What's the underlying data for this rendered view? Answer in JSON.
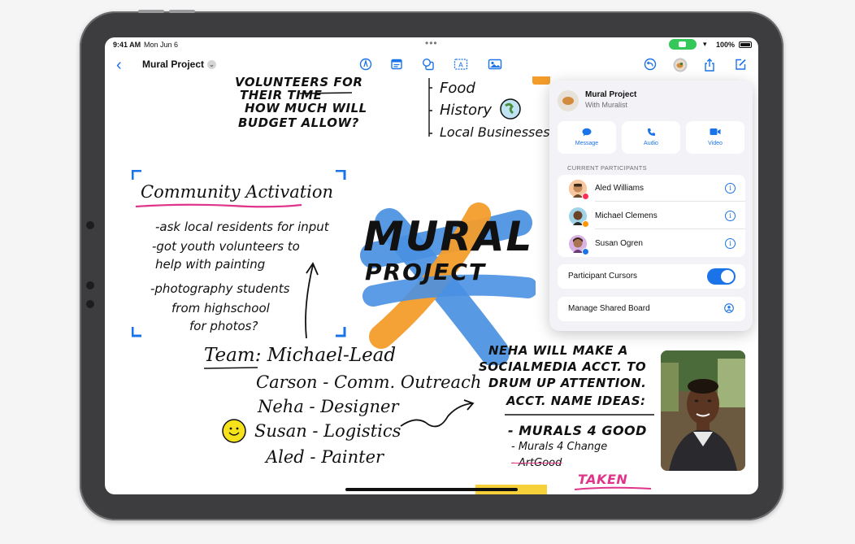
{
  "status_bar": {
    "time": "9:41 AM",
    "date": "Mon Jun 6",
    "battery": "100%"
  },
  "toolbar": {
    "title": "Mural Project",
    "icons": [
      "back-chevron-icon",
      "pencil-tip-icon",
      "note-icon",
      "shapes-icon",
      "text-box-icon",
      "photo-icon",
      "undo-icon",
      "collaborators-icon",
      "share-icon",
      "compose-icon"
    ]
  },
  "canvas": {
    "top_note": [
      "VOLUNTEERS FOR",
      "THEIR TIME",
      "HOW MUCH WILL",
      "BUDGET ALLOW?"
    ],
    "topic_list": [
      "Food",
      "History",
      "Local Businesses"
    ],
    "community": {
      "heading": "Community Activation",
      "items": [
        "-ask local residents for input",
        "-got youth volunteers to",
        "help with painting",
        "-photography students",
        "from highschool",
        "for photos?"
      ]
    },
    "mural_title": [
      "MURAL",
      "PROJECT"
    ],
    "team": {
      "heading": "Team: Michael-Lead",
      "members": [
        "Carson - Comm. Outreach",
        "Neha - Designer",
        "Susan - Logistics",
        "Aled - Painter"
      ]
    },
    "neha_note": [
      "NEHA WILL MAKE A",
      "SOCIALMEDIA ACCT. TO",
      "DRUM UP ATTENTION.",
      "ACCT. NAME IDEAS:"
    ],
    "name_ideas": [
      "- MURALS 4 GOOD",
      "- Murals 4 Change",
      "- ArtGood"
    ],
    "taken_label": "TAKEN"
  },
  "share_popover": {
    "title": "Mural Project",
    "subtitle": "With Muralist",
    "actions": [
      {
        "label": "Message",
        "icon": "message-bubble-icon"
      },
      {
        "label": "Audio",
        "icon": "phone-icon"
      },
      {
        "label": "Video",
        "icon": "video-camera-icon"
      }
    ],
    "participants_label": "CURRENT PARTICIPANTS",
    "participants": [
      {
        "name": "Aled Williams",
        "dot_color": "#ff2d55"
      },
      {
        "name": "Michael Clemens",
        "dot_color": "#ff9500"
      },
      {
        "name": "Susan Ogren",
        "dot_color": "#1a73e8"
      }
    ],
    "cursors_label": "Participant Cursors",
    "cursors_enabled": true,
    "manage_label": "Manage Shared Board"
  },
  "colors": {
    "accent": "#1a73e8",
    "mural_blue": "#4a90e2",
    "mural_orange": "#f39c2a",
    "highlight_pink": "#e0348a",
    "smiley_yellow": "#f5e21a"
  }
}
